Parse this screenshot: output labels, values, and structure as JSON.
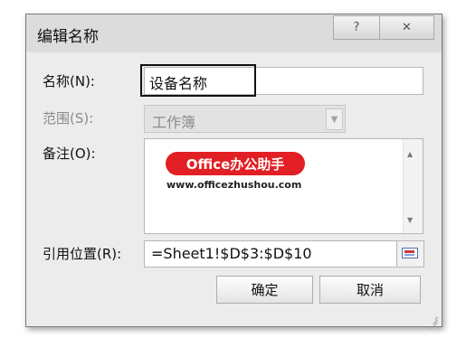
{
  "dialog": {
    "title": "编辑名称",
    "help_label": "?",
    "close_label": "✕"
  },
  "form": {
    "name_label": "名称(N):",
    "name_value": "设备名称",
    "scope_label": "范围(S):",
    "scope_value": "工作簿",
    "comment_label": "备注(O):",
    "ref_label": "引用位置(R):",
    "ref_value": "=Sheet1!$D$3:$D$10"
  },
  "watermark": {
    "brand": "Office办公助手",
    "url": "www.officezhushou.com"
  },
  "buttons": {
    "ok": "确定",
    "cancel": "取消"
  },
  "icons": {
    "scope_dropdown": "chevron-down-icon",
    "comment_scroll_up": "arrow-up-icon",
    "comment_scroll_down": "arrow-down-icon",
    "ref_collapse": "collapse-dialog-icon",
    "resize": "resize-grip-icon"
  }
}
